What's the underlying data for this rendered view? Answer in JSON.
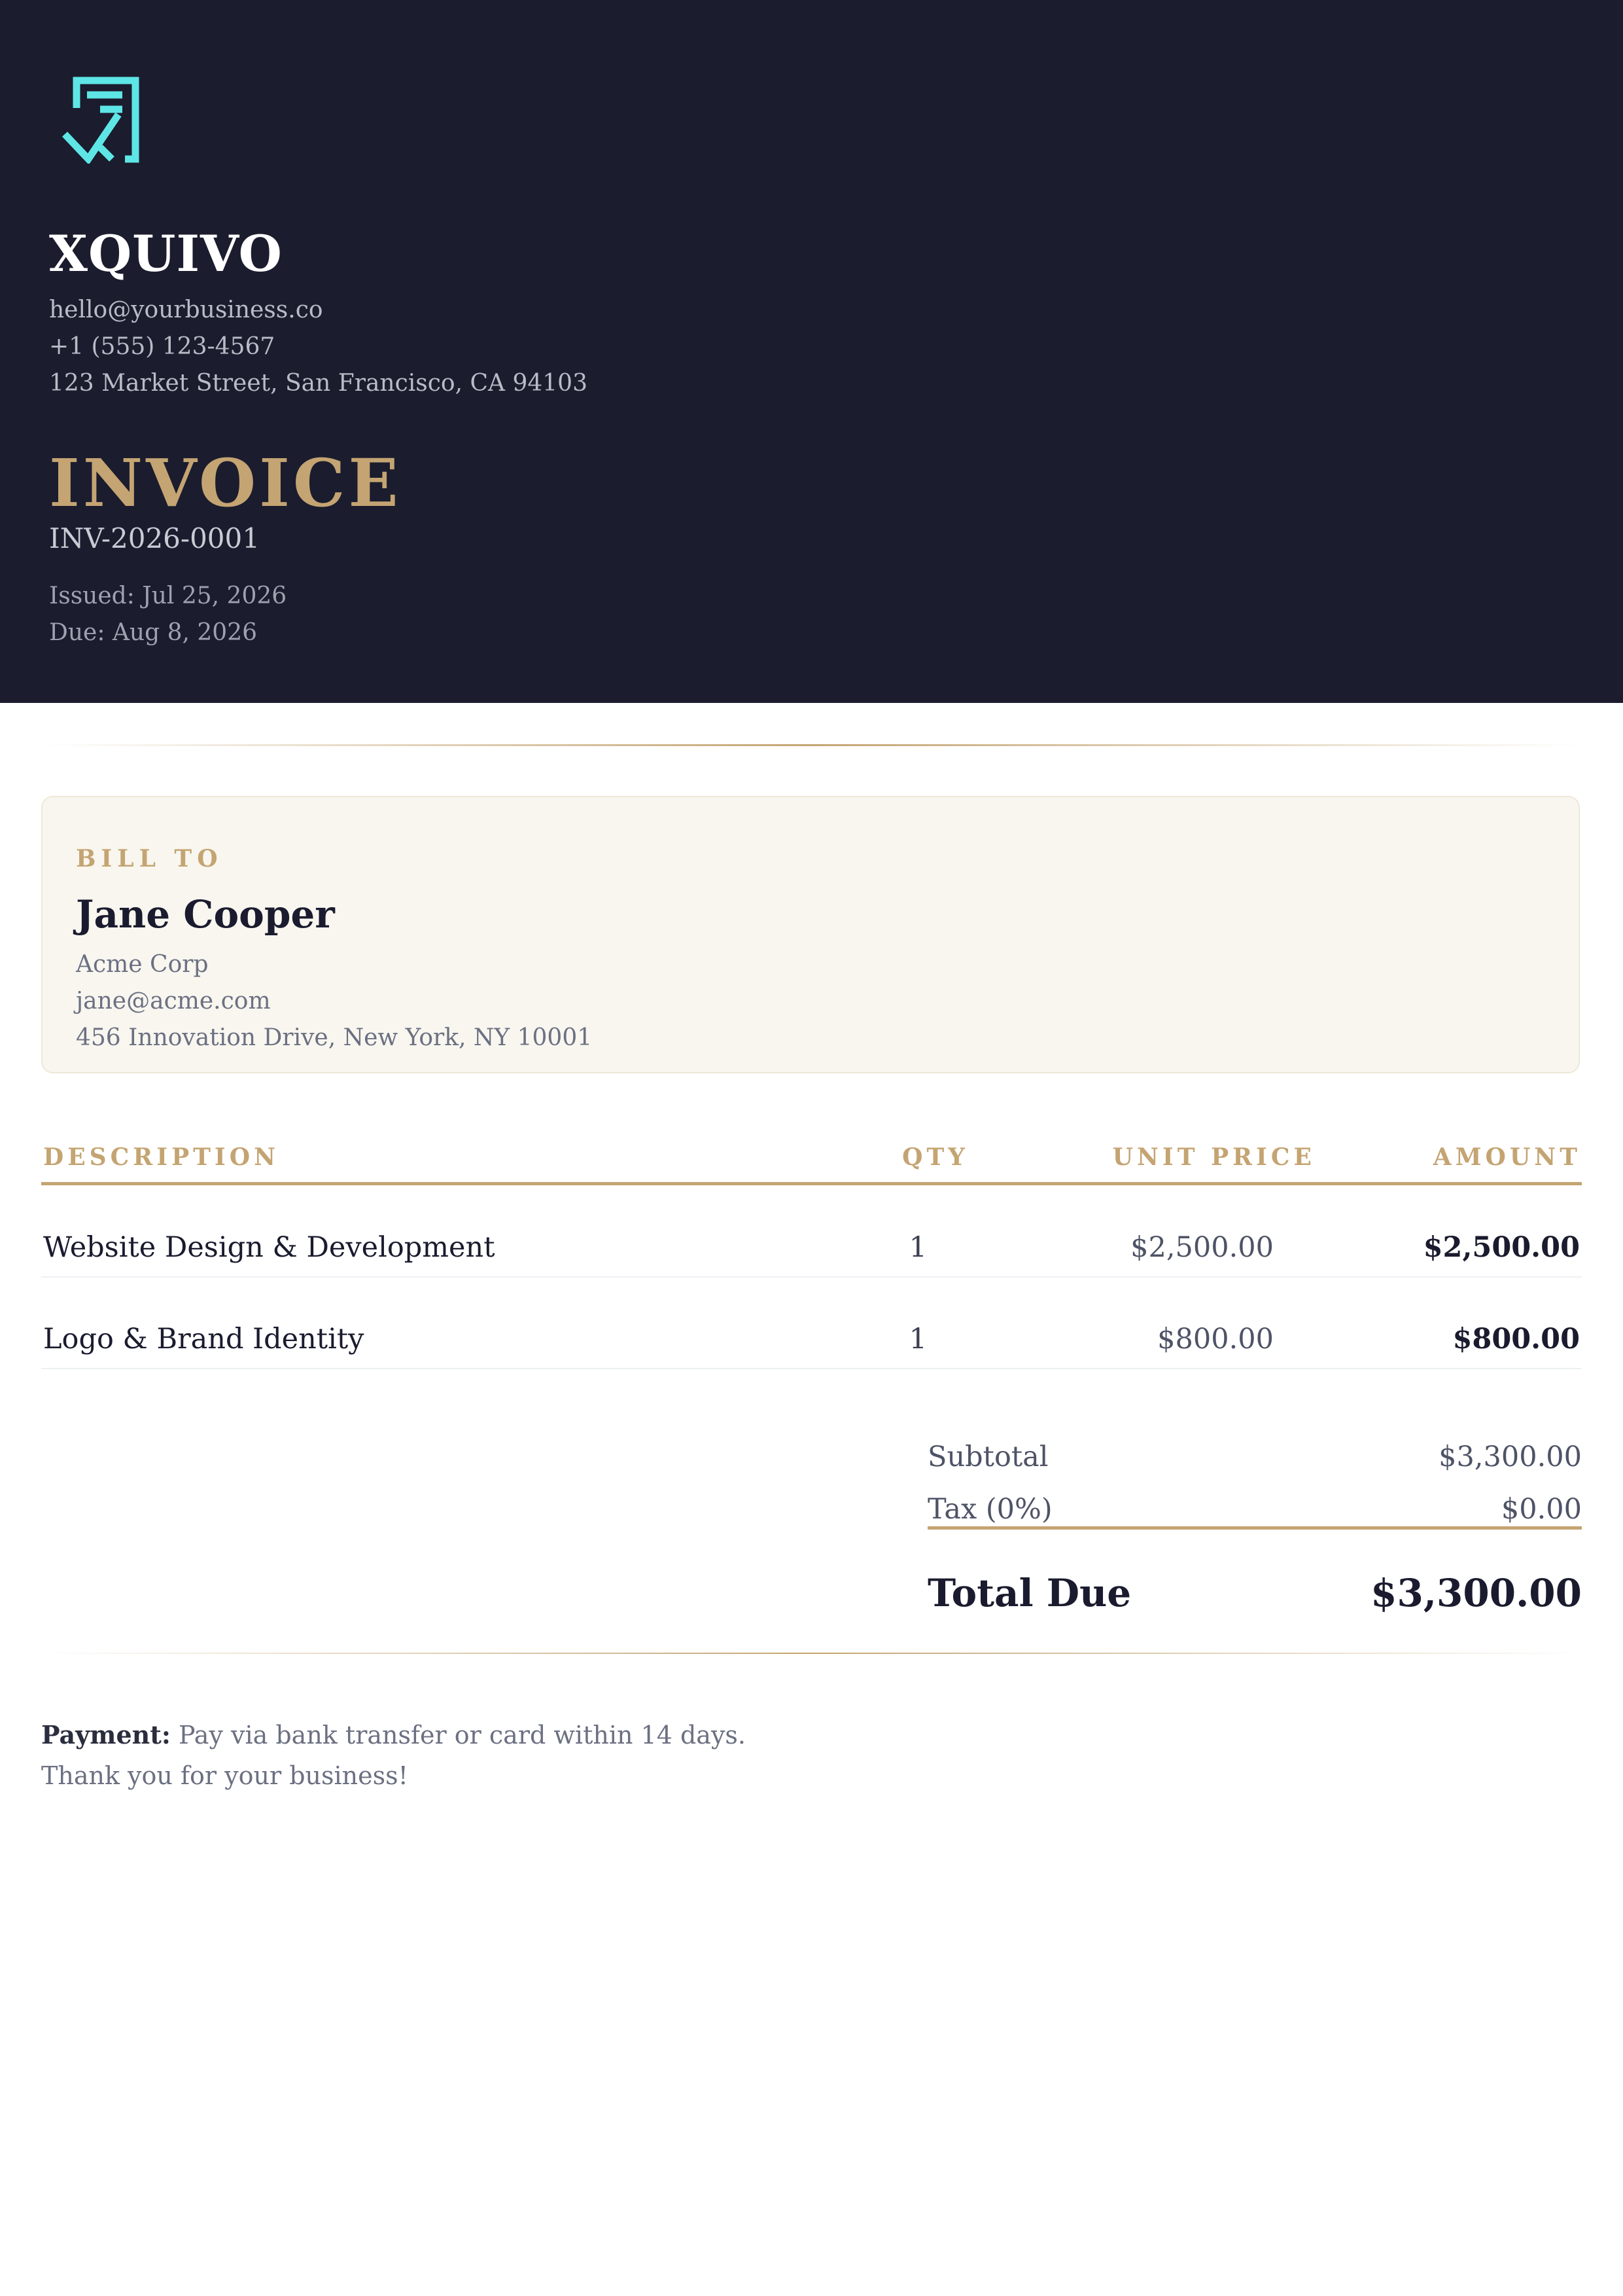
{
  "colors": {
    "header_bg": "#1b1c2e",
    "accent_gold": "#c4a472",
    "logo_cyan": "#5ee6e6",
    "billto_bg": "#f8f6ef"
  },
  "business": {
    "logo_icon": "receipt-check-icon",
    "name": "XQUIVO",
    "email": "hello@yourbusiness.co",
    "phone": "+1 (555) 123-4567",
    "address": "123 Market Street, San Francisco, CA 94103"
  },
  "invoice": {
    "title": "INVOICE",
    "number": "INV-2026-0001",
    "issued": "Issued: Jul 25, 2026",
    "due": "Due: Aug 8, 2026"
  },
  "bill_to": {
    "label": "BILL TO",
    "name": "Jane Cooper",
    "company": "Acme Corp",
    "email": "jane@acme.com",
    "address": "456 Innovation Drive, New York, NY 10001"
  },
  "table": {
    "headers": {
      "description": "DESCRIPTION",
      "qty": "QTY",
      "unit_price": "UNIT PRICE",
      "amount": "AMOUNT"
    },
    "rows": [
      {
        "description": "Website Design & Development",
        "qty": "1",
        "unit_price": "$2,500.00",
        "amount": "$2,500.00"
      },
      {
        "description": "Logo & Brand Identity",
        "qty": "1",
        "unit_price": "$800.00",
        "amount": "$800.00"
      }
    ]
  },
  "totals": {
    "subtotal_label": "Subtotal",
    "subtotal_value": "$3,300.00",
    "tax_label": "Tax (0%)",
    "tax_value": "$0.00",
    "total_label": "Total Due",
    "total_value": "$3,300.00"
  },
  "footer": {
    "payment_label": "Payment:",
    "payment_text": " Pay via bank transfer or card within 14 days.",
    "thanks": "Thank you for your business!"
  }
}
